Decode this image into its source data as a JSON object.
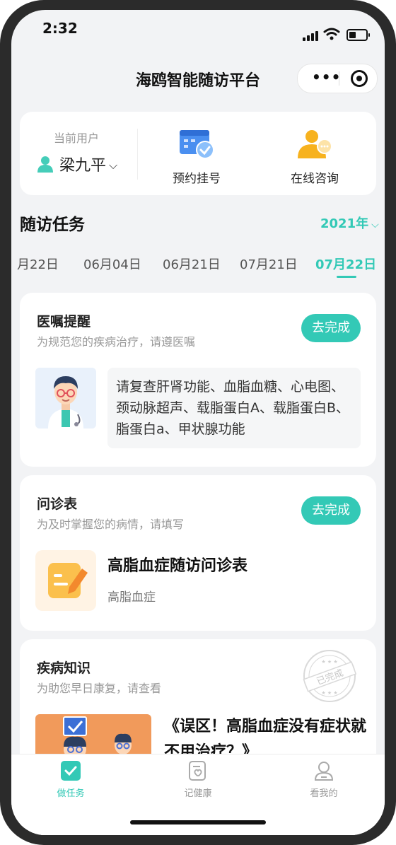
{
  "status_bar": {
    "time": "2:32"
  },
  "nav": {
    "title": "海鸥智能随访平台"
  },
  "user_card": {
    "label": "当前用户",
    "user_name": "梁九平",
    "actions": [
      {
        "label": "预约挂号"
      },
      {
        "label": "在线咨询"
      }
    ]
  },
  "section": {
    "title": "随访任务",
    "year": "2021年"
  },
  "dates": [
    "月22日",
    "06月04日",
    "06月21日",
    "07月21日",
    "07月22日"
  ],
  "active_date_index": 4,
  "tasks": [
    {
      "title": "医嘱提醒",
      "subtitle": "为规范您的疾病治疗，请遵医嘱",
      "button": "去完成",
      "content": "请复查肝肾功能、血脂血糖、心电图、颈动脉超声、载脂蛋白A、载脂蛋白B、脂蛋白a、甲状腺功能"
    },
    {
      "title": "问诊表",
      "subtitle": "为及时掌握您的病情，请填写",
      "button": "去完成",
      "form_name": "高脂血症随访问诊表",
      "form_tag": "高脂血症"
    },
    {
      "title": "疾病知识",
      "subtitle": "为助您早日康复，请查看",
      "stamp": "已完成",
      "article_title": "《误区！高脂血症没有症状就不用治疗？》"
    }
  ],
  "tabbar": {
    "items": [
      {
        "label": "做任务"
      },
      {
        "label": "记健康"
      },
      {
        "label": "看我的"
      }
    ],
    "active_index": 0
  },
  "colors": {
    "accent": "#33c9b6",
    "background": "#f2f3f5"
  }
}
